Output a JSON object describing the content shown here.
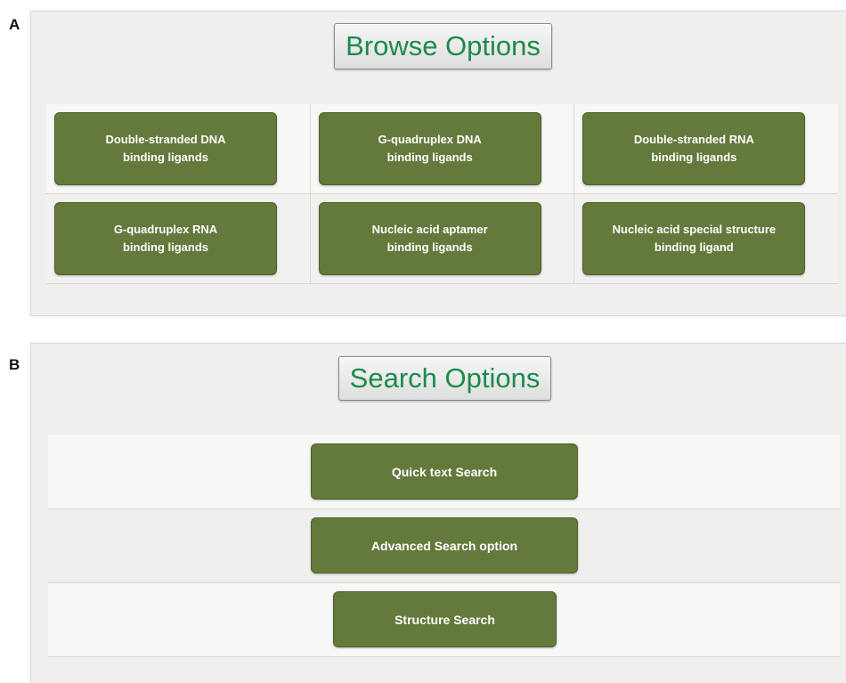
{
  "panel_a": {
    "letter": "A",
    "heading": "Browse Options",
    "rows": [
      [
        {
          "line1": "Double-stranded DNA",
          "line2": "binding ligands"
        },
        {
          "line1": "G-quadruplex DNA",
          "line2": "binding ligands"
        },
        {
          "line1": "Double-stranded RNA",
          "line2": "binding ligands"
        }
      ],
      [
        {
          "line1": "G-quadruplex RNA",
          "line2": "binding ligands"
        },
        {
          "line1": "Nucleic acid aptamer",
          "line2": "binding ligands"
        },
        {
          "line1": "Nucleic acid special structure",
          "line2": "binding ligand"
        }
      ]
    ]
  },
  "panel_b": {
    "letter": "B",
    "heading": "Search Options",
    "buttons": {
      "quick": "Quick text Search",
      "advanced": "Advanced Search option",
      "structure": "Structure Search"
    }
  },
  "colors": {
    "button_green": "#64793c",
    "heading_text": "#1b8a4c",
    "panel_bg": "#f0efee"
  }
}
